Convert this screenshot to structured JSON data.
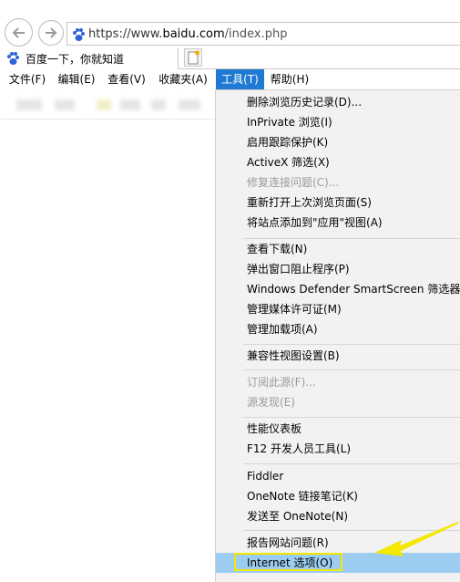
{
  "browser": {
    "url": {
      "scheme": "https://www.",
      "domain": "baidu.com",
      "path": "/index.php"
    },
    "tab_title": "百度一下，你就知道",
    "icons": {
      "back": "back-arrow-icon",
      "forward": "forward-arrow-icon",
      "favicon": "baidu-paw-icon",
      "new_tab": "new-tab-icon"
    }
  },
  "menubar": {
    "items": [
      {
        "label": "文件(F)"
      },
      {
        "label": "编辑(E)"
      },
      {
        "label": "查看(V)"
      },
      {
        "label": "收藏夹(A)"
      },
      {
        "label": "工具(T)",
        "active": true
      },
      {
        "label": "帮助(H)"
      }
    ]
  },
  "tools_menu": {
    "groups": [
      [
        {
          "label": "删除浏览历史记录(D)...",
          "enabled": true
        },
        {
          "label": "InPrivate 浏览(I)",
          "enabled": true
        },
        {
          "label": "启用跟踪保护(K)",
          "enabled": true
        },
        {
          "label": "ActiveX 筛选(X)",
          "enabled": true
        },
        {
          "label": "修复连接问题(C)...",
          "enabled": false
        },
        {
          "label": "重新打开上次浏览页面(S)",
          "enabled": true
        },
        {
          "label": "将站点添加到\"应用\"视图(A)",
          "enabled": true
        }
      ],
      [
        {
          "label": "查看下载(N)",
          "enabled": true
        },
        {
          "label": "弹出窗口阻止程序(P)",
          "enabled": true
        },
        {
          "label": "Windows Defender SmartScreen 筛选器(",
          "enabled": true
        },
        {
          "label": "管理媒体许可证(M)",
          "enabled": true
        },
        {
          "label": "管理加载项(A)",
          "enabled": true
        }
      ],
      [
        {
          "label": "兼容性视图设置(B)",
          "enabled": true
        }
      ],
      [
        {
          "label": "订阅此源(F)...",
          "enabled": false
        },
        {
          "label": "源发现(E)",
          "enabled": false
        }
      ],
      [
        {
          "label": "性能仪表板",
          "enabled": true
        },
        {
          "label": "F12 开发人员工具(L)",
          "enabled": true
        }
      ],
      [
        {
          "label": "Fiddler",
          "enabled": true
        },
        {
          "label": "OneNote 链接笔记(K)",
          "enabled": true
        },
        {
          "label": "发送至 OneNote(N)",
          "enabled": true
        }
      ],
      [
        {
          "label": "报告网站问题(R)",
          "enabled": true
        },
        {
          "label": "Internet 选项(O)",
          "enabled": true,
          "highlighted": true
        }
      ]
    ]
  },
  "colors": {
    "menu_active": "#1e7ad2",
    "item_highlight": "#9ccdf0",
    "annotation": "#f3e800"
  }
}
